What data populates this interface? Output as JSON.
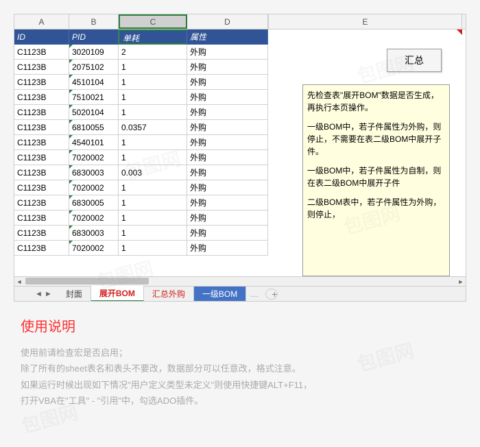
{
  "columns": [
    "A",
    "B",
    "C",
    "D",
    "E"
  ],
  "headers": {
    "id": "ID",
    "pid": "PID",
    "consumption": "单耗",
    "attribute": "属性"
  },
  "rows": [
    {
      "id": "C1123B",
      "pid": "3020109",
      "cons": "2",
      "attr": "外购"
    },
    {
      "id": "C1123B",
      "pid": "2075102",
      "cons": "1",
      "attr": "外购"
    },
    {
      "id": "C1123B",
      "pid": "4510104",
      "cons": "1",
      "attr": "外购"
    },
    {
      "id": "C1123B",
      "pid": "7510021",
      "cons": "1",
      "attr": "外购"
    },
    {
      "id": "C1123B",
      "pid": "5020104",
      "cons": "1",
      "attr": "外购"
    },
    {
      "id": "C1123B",
      "pid": "6810055",
      "cons": "0.0357",
      "attr": "外购"
    },
    {
      "id": "C1123B",
      "pid": "4540101",
      "cons": "1",
      "attr": "外购"
    },
    {
      "id": "C1123B",
      "pid": "7020002",
      "cons": "1",
      "attr": "外购"
    },
    {
      "id": "C1123B",
      "pid": "6830003",
      "cons": "0.003",
      "attr": "外购"
    },
    {
      "id": "C1123B",
      "pid": "7020002",
      "cons": "1",
      "attr": "外购"
    },
    {
      "id": "C1123B",
      "pid": "6830005",
      "cons": "1",
      "attr": "外购"
    },
    {
      "id": "C1123B",
      "pid": "7020002",
      "cons": "1",
      "attr": "外购"
    },
    {
      "id": "C1123B",
      "pid": "6830003",
      "cons": "1",
      "attr": "外购"
    },
    {
      "id": "C1123B",
      "pid": "7020002",
      "cons": "1",
      "attr": "外购"
    }
  ],
  "summary_button": "汇总",
  "info_box": {
    "p1": "先检查表\"展开BOM\"数据是否生成，再执行本页操作。",
    "p2": "一级BOM中，若子件属性为外购，则停止，不需要在表二级BOM中展开子件。",
    "p3": "一级BOM中，若子件属性为自制，则在表二级BOM中展开子件",
    "p4": "二级BOM表中，若子件属性为外购，则停止，"
  },
  "tabs": {
    "t1": "封面",
    "t2": "展开BOM",
    "t3": "汇总外购",
    "t4": "一级BOM"
  },
  "instructions": {
    "title": "使用说明",
    "line1": "使用前请检查宏是否启用；",
    "line2": "除了所有的sheet表名和表头不要改，数据部分可以任意改，格式注意。",
    "line3": "如果运行时候出现如下情况\"用户定义类型未定义\"则使用快捷键ALT+F11，",
    "line4": "打开VBA在\"工具\" - \"引用\"中，勾选ADO插件。"
  },
  "watermark": "包图网"
}
